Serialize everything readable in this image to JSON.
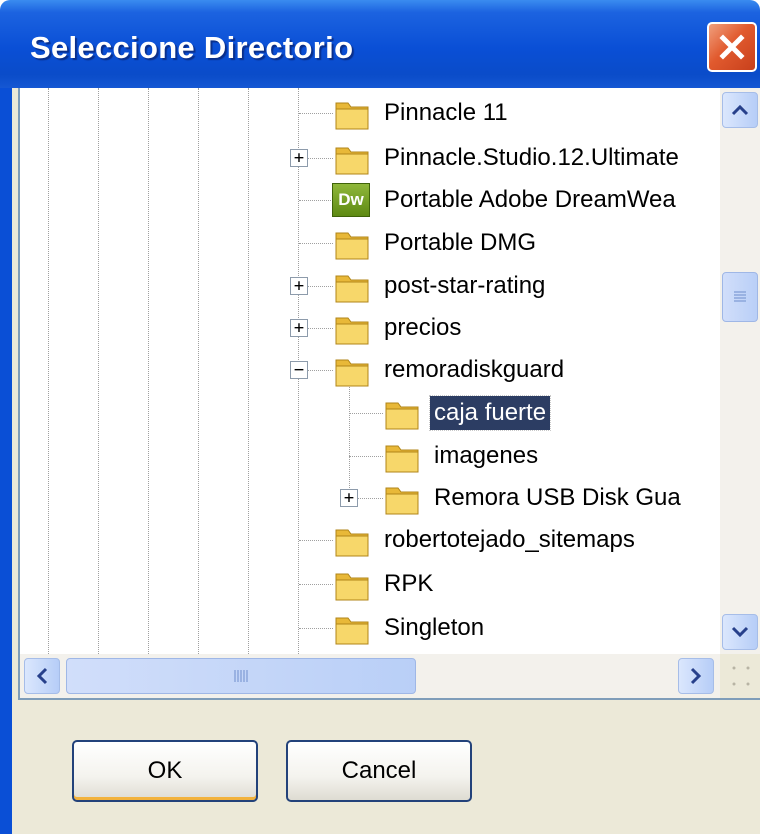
{
  "window": {
    "title": "Seleccione Directorio",
    "close_icon": "close-icon"
  },
  "tree": {
    "items": [
      {
        "label": "Pinnacle 11",
        "icon": "folder-icon",
        "expander": ""
      },
      {
        "label": "Pinnacle.Studio.12.Ultimate",
        "icon": "folder-icon",
        "expander": "+"
      },
      {
        "label": "Portable Adobe DreamWea",
        "icon": "dreamweaver-icon",
        "icon_text": "Dw",
        "expander": ""
      },
      {
        "label": "Portable DMG",
        "icon": "folder-icon",
        "expander": ""
      },
      {
        "label": "post-star-rating",
        "icon": "folder-icon",
        "expander": "+"
      },
      {
        "label": "precios",
        "icon": "folder-icon",
        "expander": "+"
      },
      {
        "label": "remoradiskguard",
        "icon": "folder-icon",
        "expander": "−"
      },
      {
        "label": "caja fuerte",
        "icon": "folder-icon",
        "expander": "",
        "selected": true
      },
      {
        "label": "imagenes",
        "icon": "folder-icon",
        "expander": ""
      },
      {
        "label": "Remora USB Disk Gua",
        "icon": "folder-icon",
        "expander": "+"
      },
      {
        "label": "robertotejado_sitemaps",
        "icon": "folder-icon",
        "expander": ""
      },
      {
        "label": "RPK",
        "icon": "folder-icon",
        "expander": ""
      },
      {
        "label": "Singleton",
        "icon": "folder-icon",
        "expander": ""
      }
    ]
  },
  "scrollbars": {
    "vertical_position": 0.32,
    "horizontal_position": 0
  },
  "buttons": {
    "ok": "OK",
    "cancel": "Cancel"
  },
  "colors": {
    "title_bar": "#0a4fd6",
    "selection": "#2c3d63",
    "close_button": "#e15a2e"
  }
}
